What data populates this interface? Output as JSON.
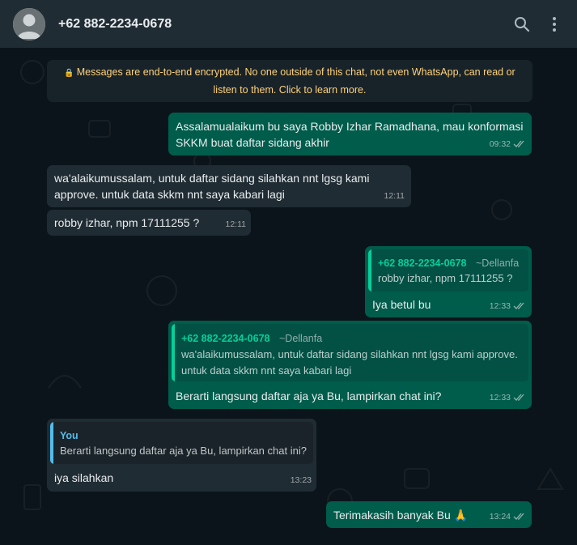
{
  "header": {
    "contact_name": "+62 882-2234-0678",
    "avatar_icon": "default-user-avatar",
    "search_icon": "search-icon",
    "menu_icon": "vertical-dots-menu-icon"
  },
  "encryption_notice": {
    "line1": "Messages are end-to-end encrypted. No one outside of this chat, not even WhatsApp, can read or",
    "line2": "listen to them. Click to learn more.",
    "icon": "lock-icon"
  },
  "colors": {
    "outgoing_bubble": "#005c4b",
    "incoming_bubble": "#202c33",
    "quote_accent_green": "#06cf9c",
    "quote_accent_blue": "#53bdeb",
    "encryption_text": "#ffd279"
  },
  "messages": [
    {
      "direction": "outgoing",
      "lines": [
        "Assalamualaikum bu saya Robby Izhar Ramadhana, mau konformasi",
        "SKKM buat daftar sidang akhir"
      ],
      "time": "09:32",
      "status": "read"
    },
    {
      "direction": "incoming",
      "lines": [
        "wa'alaikumussalam, untuk daftar sidang silahkan nnt lgsg kami",
        "approve. untuk data skkm nnt saya kabari lagi"
      ],
      "time": "12:11"
    },
    {
      "direction": "incoming",
      "lines": [
        "robby izhar, npm 17111255 ?"
      ],
      "time": "12:11"
    },
    {
      "direction": "outgoing",
      "quote": {
        "author": "+62 882-2234-0678",
        "pushname": "~Dellanfa",
        "lines": [
          "robby izhar, npm 17111255 ?"
        ]
      },
      "lines": [
        "Iya betul bu"
      ],
      "time": "12:33",
      "status": "read"
    },
    {
      "direction": "outgoing",
      "quote": {
        "author": "+62 882-2234-0678",
        "pushname": "~Dellanfa",
        "lines": [
          "wa'alaikumussalam, untuk daftar sidang silahkan nnt lgsg kami approve.",
          "untuk data skkm nnt saya kabari lagi"
        ]
      },
      "lines": [
        "Berarti langsung daftar aja ya Bu, lampirkan chat ini?"
      ],
      "time": "12:33",
      "status": "read"
    },
    {
      "direction": "incoming",
      "quote": {
        "author": "You",
        "lines": [
          "Berarti langsung daftar aja ya Bu, lampirkan chat ini?"
        ]
      },
      "lines": [
        "iya silahkan"
      ],
      "time": "13:23"
    },
    {
      "direction": "outgoing",
      "lines": [
        "Terimakasih banyak Bu 🙏"
      ],
      "time": "13:24",
      "status": "read"
    }
  ]
}
